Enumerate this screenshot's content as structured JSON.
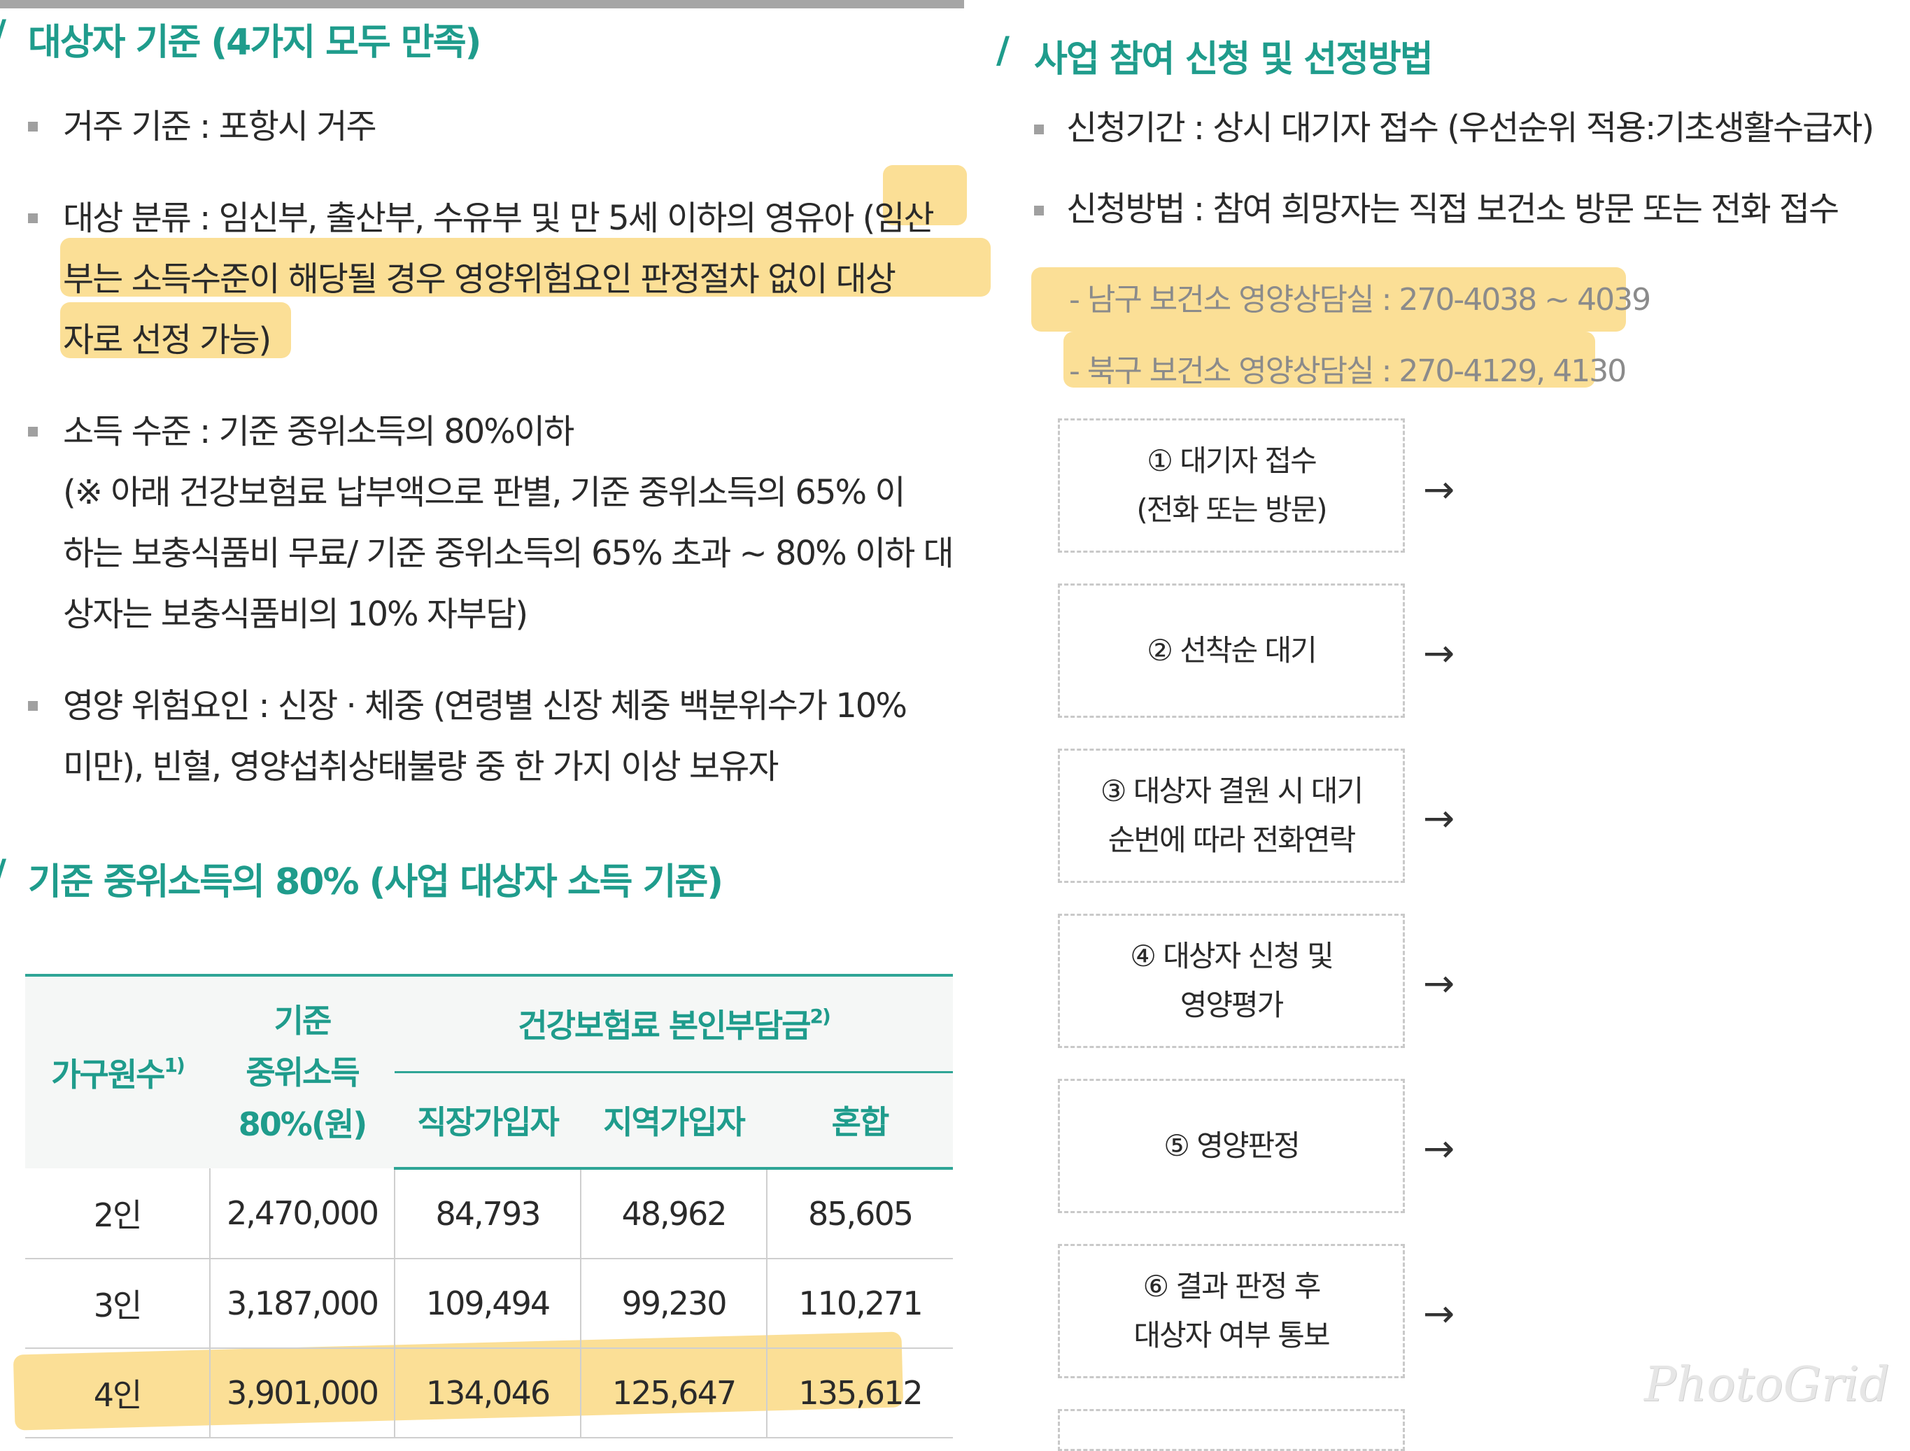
{
  "left": {
    "criteria_title": "대상자 기준 (4가지 모두 만족)",
    "criteria": [
      "거주 기준 : 포항시 거주",
      "대상 분류 : 임신부, 출산부, 수유부 및 만 5세 이하의 영유아 (임산\n부는 소득수준이 해당될 경우 영양위험요인 판정절차 없이 대상\n자로 선정 가능)",
      "소득 수준 : 기준 중위소득의 80%이하\n(※ 아래 건강보험료 납부액으로 판별, 기준 중위소득의 65% 이\n하는 보충식품비 무료/ 기준 중위소득의 65% 초과 ~ 80% 이하 대\n상자는 보충식품비의 10% 자부담)",
      "영양 위험요인 : 신장 · 체중 (연령별 신장 체중 백분위수가 10%\n미만), 빈혈, 영양섭취상태불량 중 한 가지 이상 보유자"
    ],
    "income_title": "기준 중위소득의 80% (사업 대상자 소득 기준)",
    "table": {
      "h_household": "가구원수",
      "h_household_sup": "1)",
      "h_income": "기준\n중위소득\n80%(원)",
      "h_premium": "건강보험료 본인부담금",
      "h_premium_sup": "2)",
      "h_employee": "직장가입자",
      "h_regional": "지역가입자",
      "h_mixed": "혼합",
      "rows": [
        [
          "2인",
          "2,470,000",
          "84,793",
          "48,962",
          "85,605"
        ],
        [
          "3인",
          "3,187,000",
          "109,494",
          "99,230",
          "110,271"
        ],
        [
          "4인",
          "3,901,000",
          "134,046",
          "125,647",
          "135,612"
        ]
      ]
    }
  },
  "right": {
    "title": "사업 참여 신청 및 선정방법",
    "items": [
      "신청기간 : 상시 대기자 접수 (우선순위 적용:기초생활수급자)",
      "신청방법 : 참여 희망자는 직접 보건소 방문 또는 전화 접수"
    ],
    "subs": [
      "- 남구 보건소 영양상담실 : 270-4038 ~ 4039",
      "- 북구 보건소 영양상담실 : 270-4129, 4130"
    ],
    "steps": [
      "① 대기자 접수\n(전화 또는 방문)",
      "② 선착순 대기",
      "③ 대상자 결원 시 대기\n순번에 따라 전화연락",
      "④ 대상자 신청 및\n영양평가",
      "⑤ 영양판정",
      "⑥ 결과 판정 후\n대상자 여부 통보"
    ],
    "arrow": "→"
  },
  "watermark": "PhotoGrid",
  "colors": {
    "accent": "#1f9c8c",
    "highlight": "#f7c440"
  }
}
